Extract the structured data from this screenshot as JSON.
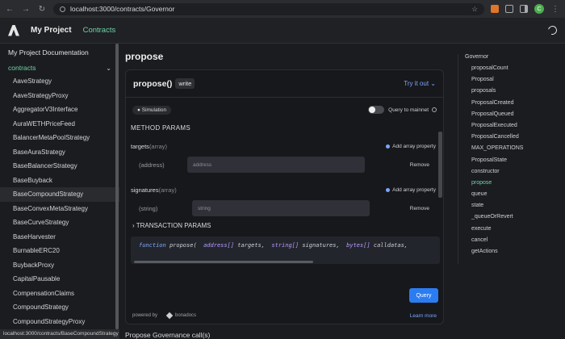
{
  "browser": {
    "url": "localhost:3000/contracts/Governor",
    "profile_initial": "C",
    "status_url": "localhost:3000/contracts/BaseCompoundStrategy"
  },
  "header": {
    "brand": "My Project",
    "nav_contracts": "Contracts"
  },
  "sidebar": {
    "doc_link": "My Project Documentation",
    "section": "contracts",
    "items": [
      "AaveStrategy",
      "AaveStrategyProxy",
      "AggregatorV3Interface",
      "AuraWETHPriceFeed",
      "BalancerMetaPoolStrategy",
      "BaseAuraStrategy",
      "BaseBalancerStrategy",
      "BaseBuyback",
      "BaseCompoundStrategy",
      "BaseConvexMetaStrategy",
      "BaseCurveStrategy",
      "BaseHarvester",
      "BurnableERC20",
      "BuybackProxy",
      "CapitalPausable",
      "CompensationClaims",
      "CompoundStrategy",
      "CompoundStrategyProxy"
    ],
    "active_index": 8
  },
  "main": {
    "title": "propose",
    "function_name": "propose()",
    "badge": "write",
    "try_it": "Try it out",
    "simulation": "Simulation",
    "mainnet": "Query to mainnet",
    "method_params": "METHOD PARAMS",
    "params": [
      {
        "name": "targets",
        "type": "(array)",
        "sub_type": "(address)",
        "placeholder": "address",
        "add": "Add array property",
        "remove": "Remove"
      },
      {
        "name": "signatures",
        "type": "(array)",
        "sub_type": "(string)",
        "placeholder": "string",
        "add": "Add array property",
        "remove": "Remove"
      }
    ],
    "tx_params": "TRANSACTION PARAMS",
    "code": {
      "kw_function": "function",
      "name": "propose(",
      "t1": "address[]",
      "a1": "targets,",
      "t2": "string[]",
      "a2": "signatures,",
      "t3": "bytes[]",
      "a3": "calldatas,"
    },
    "query_button": "Query",
    "powered_by": "powered by",
    "powered_brand": "bonadocs",
    "learn_more": "Learn more",
    "subtitle": "Propose Governance call(s)"
  },
  "toc": {
    "title": "Governor",
    "items": [
      "proposalCount",
      "Proposal",
      "proposals",
      "ProposalCreated",
      "ProposalQueued",
      "ProposalExecuted",
      "ProposalCancelled",
      "MAX_OPERATIONS",
      "ProposalState",
      "constructor",
      "propose",
      "queue",
      "state",
      "_queueOrRevert",
      "execute",
      "cancel",
      "getActions"
    ],
    "active_index": 10
  },
  "colors": {
    "accent_green": "#6fd3a6",
    "link_blue": "#7aa6ff",
    "button_blue": "#2b7cf0"
  }
}
